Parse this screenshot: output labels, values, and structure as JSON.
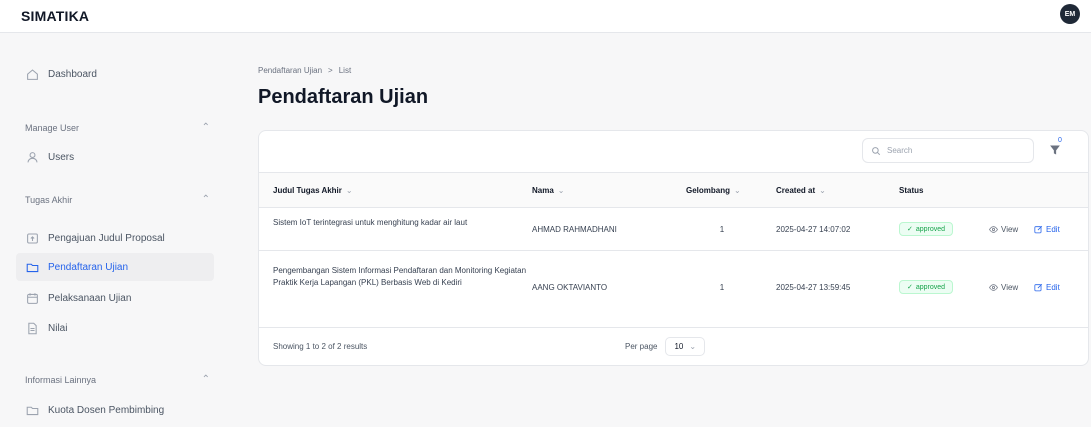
{
  "app": {
    "brand": "SIMATIKA",
    "avatar_initials": "EM"
  },
  "sidebar": {
    "dashboard": "Dashboard",
    "groups": [
      {
        "label": "Manage User",
        "items": [
          {
            "label": "Users",
            "icon": "user-icon"
          }
        ]
      },
      {
        "label": "Tugas Akhir",
        "items": [
          {
            "label": "Pengajuan Judul Proposal",
            "icon": "document-upload-icon"
          },
          {
            "label": "Pendaftaran Ujian",
            "icon": "folder-icon",
            "active": true
          },
          {
            "label": "Pelaksanaan Ujian",
            "icon": "calendar-icon"
          },
          {
            "label": "Nilai",
            "icon": "document-icon"
          }
        ]
      },
      {
        "label": "Informasi Lainnya",
        "items": [
          {
            "label": "Kuota Dosen Pembimbing",
            "icon": "folder-icon"
          }
        ]
      }
    ]
  },
  "breadcrumb": {
    "parent": "Pendaftaran Ujian",
    "separator": ">",
    "current": "List"
  },
  "page": {
    "title": "Pendaftaran Ujian"
  },
  "toolbar": {
    "search_placeholder": "Search",
    "filter_count": "0"
  },
  "table": {
    "headers": {
      "judul": "Judul Tugas Akhir",
      "nama": "Nama",
      "gelombang": "Gelombang",
      "created": "Created at",
      "status": "Status"
    },
    "rows": [
      {
        "judul": "Sistem IoT terintegrasi untuk menghitung kadar air laut",
        "nama": "AHMAD RAHMADHANI",
        "gelombang": "1",
        "created": "2025-04-27 14:07:02",
        "status": "approved",
        "view": "View",
        "edit": "Edit"
      },
      {
        "judul": "Pengembangan Sistem Informasi Pendaftaran dan Monitoring Kegiatan Praktik Kerja Lapangan (PKL) Berbasis Web di Kediri",
        "nama": "AANG OKTAVIANTO",
        "gelombang": "1",
        "created": "2025-04-27 13:59:45",
        "status": "approved",
        "view": "View",
        "edit": "Edit"
      }
    ]
  },
  "footer": {
    "results": "Showing 1 to 2 of 2 results",
    "per_page_label": "Per page",
    "per_page_value": "10"
  },
  "colors": {
    "accent": "#2563eb",
    "approved": "#16a34a"
  }
}
